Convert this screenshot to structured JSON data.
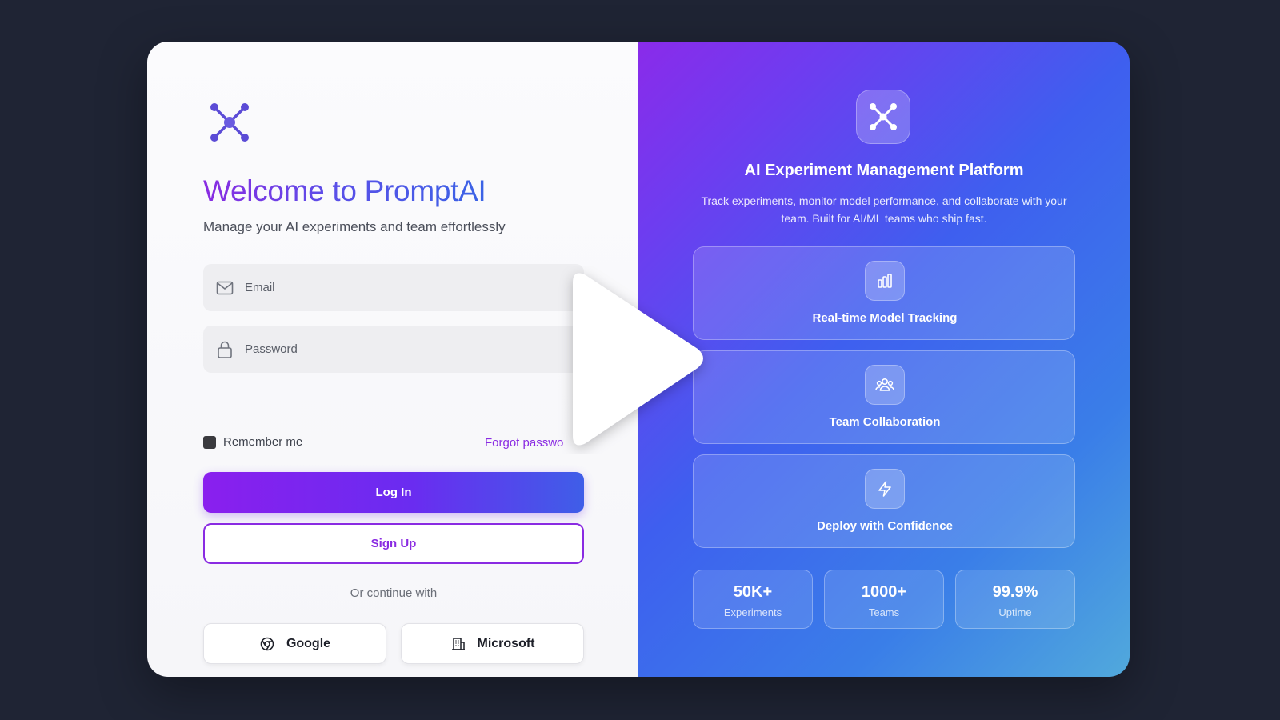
{
  "login": {
    "title": "Welcome to PromptAI",
    "subtitle": "Manage your AI experiments and team effortlessly",
    "email_placeholder": "Email",
    "password_placeholder": "Password",
    "remember_label": "Remember me",
    "forgot_label": "Forgot passwo",
    "login_label": "Log In",
    "signup_label": "Sign Up",
    "divider_label": "Or continue with",
    "social": [
      {
        "label": "Google",
        "icon": "chrome-icon"
      },
      {
        "label": "Microsoft",
        "icon": "building-icon"
      }
    ]
  },
  "promo": {
    "title": "AI Experiment Management Platform",
    "description": "Track experiments, monitor model performance, and collaborate with your team. Built for AI/ML teams who ship fast.",
    "features": [
      {
        "label": "Real-time Model Tracking",
        "icon": "bar-chart-icon"
      },
      {
        "label": "Team Collaboration",
        "icon": "users-icon"
      },
      {
        "label": "Deploy with Confidence",
        "icon": "lightning-icon"
      }
    ],
    "stats": [
      {
        "value": "50K+",
        "label": "Experiments"
      },
      {
        "value": "1000+",
        "label": "Teams"
      },
      {
        "value": "99.9%",
        "label": "Uptime"
      }
    ]
  },
  "colors": {
    "background": "#1f2434",
    "accent_purple": "#8a2be2",
    "accent_blue": "#3f5ee8"
  },
  "overlay": {
    "icon": "play-icon"
  }
}
